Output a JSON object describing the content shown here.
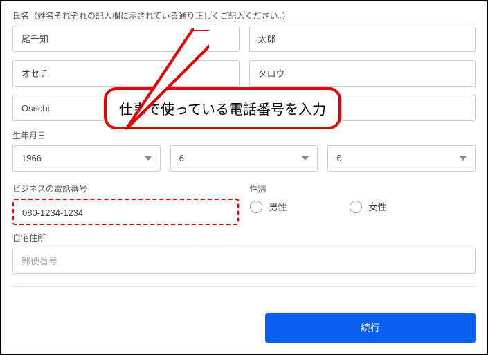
{
  "labels": {
    "name_section": "氏名（姓名それぞれの記入欄に示されている通り正しくご記入ください。）",
    "dob": "生年月日",
    "business_phone": "ビジネスの電話番号",
    "gender": "性別",
    "home_address": "自宅住所"
  },
  "name": {
    "last_kanji": "尾千知",
    "first_kanji": "太郎",
    "last_kana": "オセチ",
    "first_kana": "タロウ",
    "last_roman": "Osechi",
    "first_roman": ""
  },
  "dob": {
    "year": "1966",
    "month": "6",
    "day": "6"
  },
  "phone": "080-1234-1234",
  "gender_options": {
    "male": "男性",
    "female": "女性"
  },
  "address": {
    "postal_placeholder": "郵便番号"
  },
  "button": {
    "continue": "続行"
  },
  "callout_text": "仕事で使っている電話番号を入力"
}
